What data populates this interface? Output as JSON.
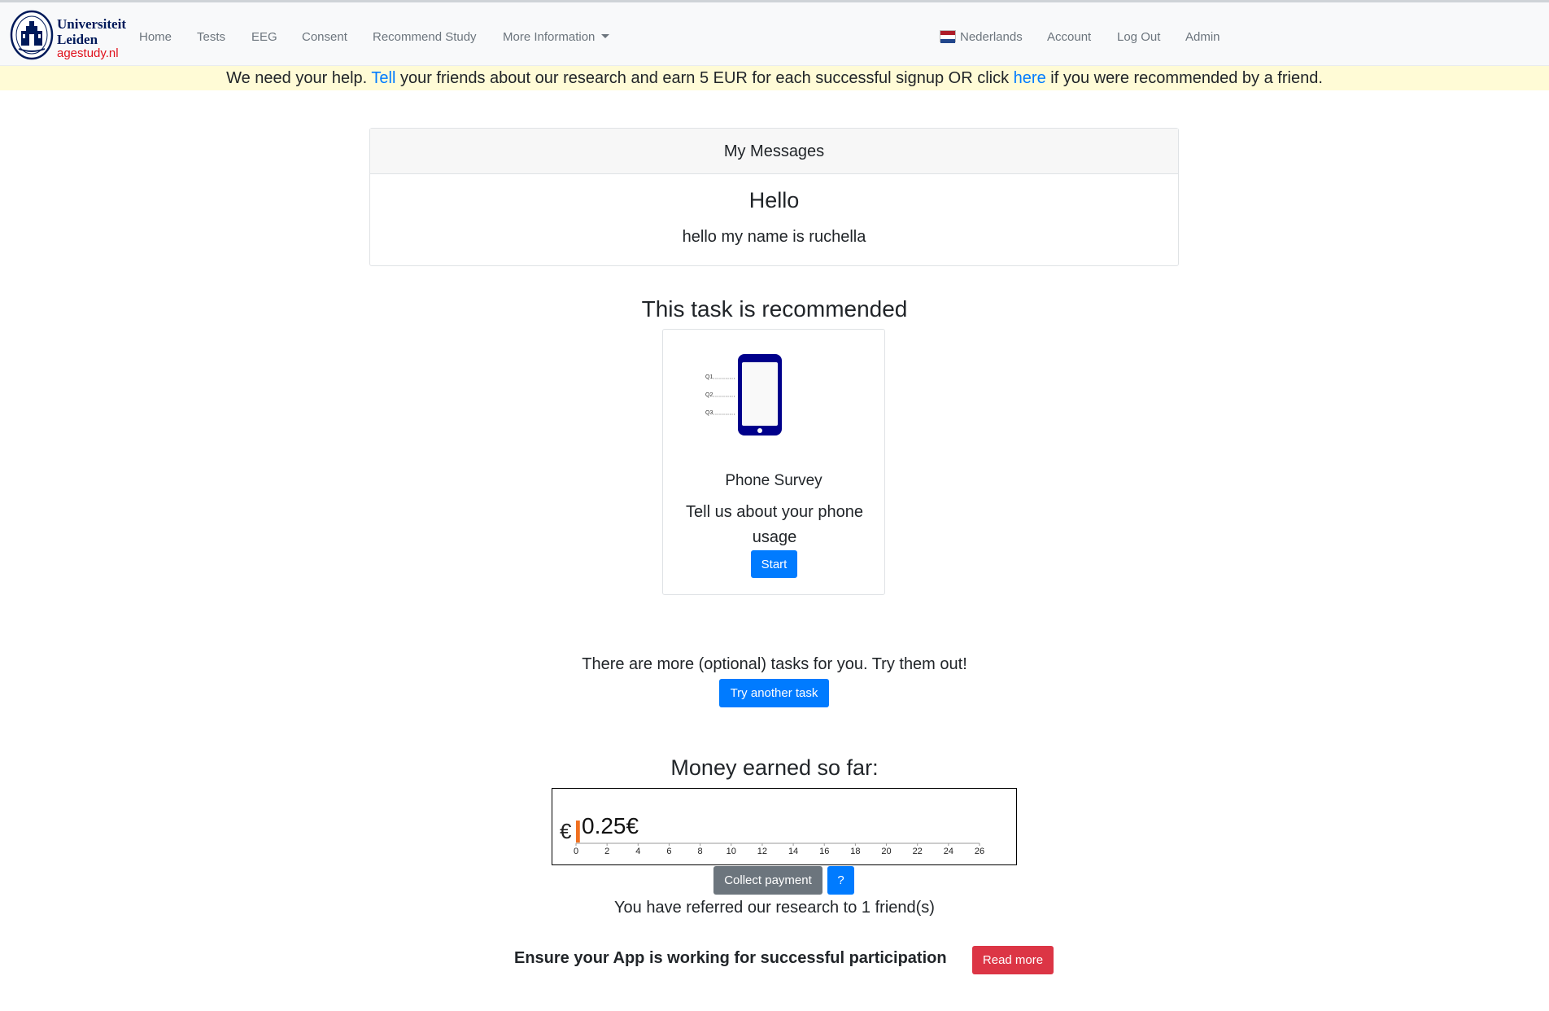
{
  "brand": {
    "university_line1": "Universiteit",
    "university_line2": "Leiden",
    "site": "agestudy.nl",
    "seal_text": "LEIDEN UNIVERSITY"
  },
  "nav": {
    "items": [
      "Home",
      "Tests",
      "EEG",
      "Consent",
      "Recommend Study",
      "More Information"
    ],
    "right": {
      "language": "Nederlands",
      "account": "Account",
      "logout": "Log Out",
      "admin": "Admin"
    }
  },
  "banner": {
    "part1": "We need your help. ",
    "link1": "Tell",
    "part2": " your friends about our research and earn 5 EUR for each successful signup OR click ",
    "link2": "here",
    "part3": " if you were recommended by a friend."
  },
  "messages": {
    "header": "My Messages",
    "title": "Hello",
    "body": "hello my name is ruchella"
  },
  "recommended": {
    "heading": "This task is recommended",
    "task": {
      "name": "Phone Survey",
      "description": "Tell us about your phone usage",
      "start_label": "Start",
      "illustration_labels": [
        "Q1",
        "Q2",
        "Q3"
      ]
    }
  },
  "more_tasks": {
    "text": "There are more (optional) tasks for you. Try them out!",
    "button": "Try another task"
  },
  "money": {
    "heading": "Money earned so far:",
    "currency_symbol": "€",
    "amount_label": "0.25€",
    "collect_label": "Collect payment",
    "help_label": "?",
    "referral_text": "You have referred our research to 1 friend(s)"
  },
  "chart_data": {
    "type": "bar",
    "orientation": "horizontal",
    "values": [
      0.25
    ],
    "xlim": [
      0,
      26
    ],
    "ticks": [
      0,
      2,
      4,
      6,
      8,
      10,
      12,
      14,
      16,
      18,
      20,
      22,
      24,
      26
    ],
    "bar_color": "#f07020"
  },
  "notice": {
    "text": "Ensure your App is working for successful participation",
    "button": "Read more"
  },
  "colors": {
    "primary": "#007bff",
    "danger": "#dc3545",
    "secondary": "#6c757d",
    "banner_bg": "#fffbd6",
    "phone_blue": "#00008b",
    "brand_navy": "#001a5a",
    "brand_red": "#e0101b"
  }
}
